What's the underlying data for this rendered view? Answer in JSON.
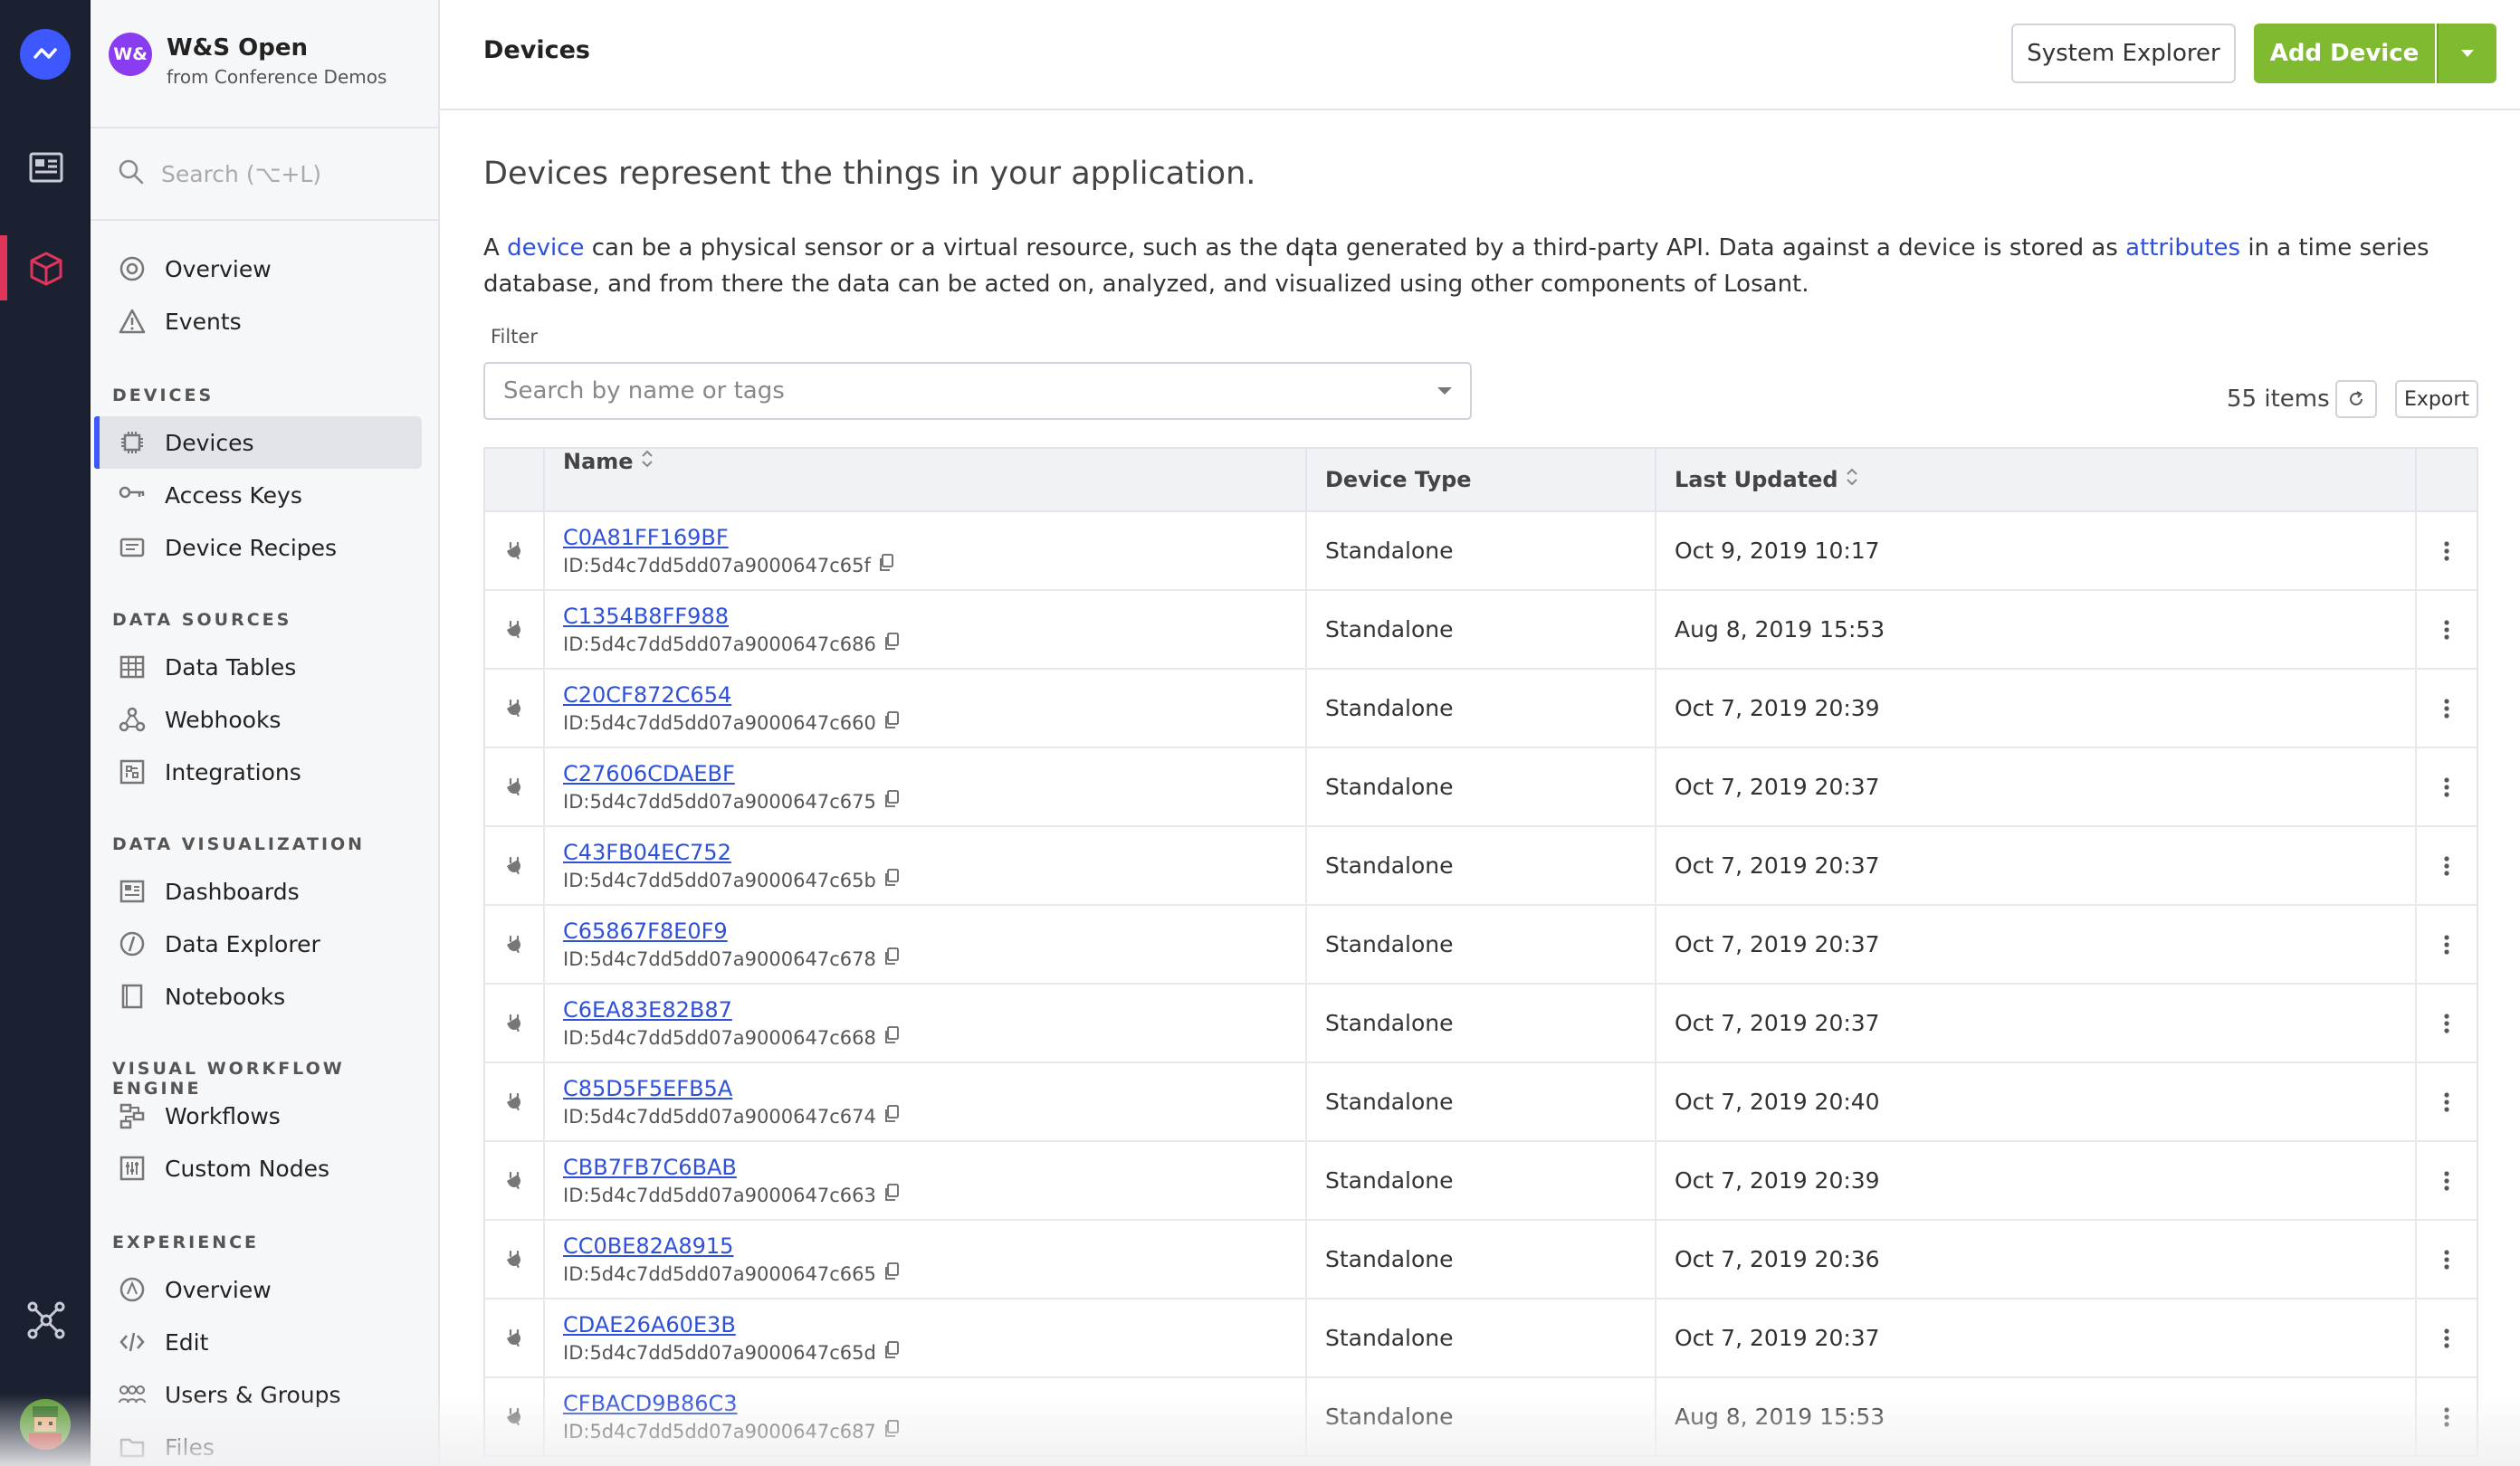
{
  "org": {
    "badge": "W&",
    "name": "W&S Open",
    "subtitle": "from Conference Demos"
  },
  "search": {
    "placeholder": "Search (⌥+L)"
  },
  "nav": {
    "overview": "Overview",
    "events": "Events",
    "sections": {
      "devices": "DEVICES",
      "data_sources": "DATA SOURCES",
      "data_visualization": "DATA VISUALIZATION",
      "visual_workflow_engine": "VISUAL WORKFLOW ENGINE",
      "experience": "EXPERIENCE"
    },
    "devices": "Devices",
    "access_keys": "Access Keys",
    "device_recipes": "Device Recipes",
    "data_tables": "Data Tables",
    "webhooks": "Webhooks",
    "integrations": "Integrations",
    "dashboards": "Dashboards",
    "data_explorer": "Data Explorer",
    "notebooks": "Notebooks",
    "workflows": "Workflows",
    "custom_nodes": "Custom Nodes",
    "exp_overview": "Overview",
    "edit": "Edit",
    "users_groups": "Users & Groups",
    "files": "Files"
  },
  "header": {
    "title": "Devices",
    "system_explorer": "System Explorer",
    "add_device": "Add Device"
  },
  "content": {
    "lead": "Devices represent the things in your application.",
    "desc_1": "A ",
    "desc_link_device": "device",
    "desc_2": " can be a physical sensor or a virtual resource, such as the data generated by a third-party API. Data against a device is stored as ",
    "desc_link_attributes": "attributes",
    "desc_3": " in a time series database, and from there the data can be acted on, analyzed, and visualized using other components of Losant.",
    "filter_label": "Filter",
    "filter_placeholder": "Search by name or tags",
    "items_count": "55 items",
    "export": "Export"
  },
  "table": {
    "headers": {
      "name": "Name",
      "device_type": "Device Type",
      "last_updated": "Last Updated"
    },
    "rows": [
      {
        "name": "C0A81FF169BF",
        "id": "ID:5d4c7dd5dd07a9000647c65f",
        "type": "Standalone",
        "updated": "Oct 9, 2019 10:17"
      },
      {
        "name": "C1354B8FF988",
        "id": "ID:5d4c7dd5dd07a9000647c686",
        "type": "Standalone",
        "updated": "Aug 8, 2019 15:53"
      },
      {
        "name": "C20CF872C654",
        "id": "ID:5d4c7dd5dd07a9000647c660",
        "type": "Standalone",
        "updated": "Oct 7, 2019 20:39"
      },
      {
        "name": "C27606CDAEBF",
        "id": "ID:5d4c7dd5dd07a9000647c675",
        "type": "Standalone",
        "updated": "Oct 7, 2019 20:37"
      },
      {
        "name": "C43FB04EC752",
        "id": "ID:5d4c7dd5dd07a9000647c65b",
        "type": "Standalone",
        "updated": "Oct 7, 2019 20:37"
      },
      {
        "name": "C65867F8E0F9",
        "id": "ID:5d4c7dd5dd07a9000647c678",
        "type": "Standalone",
        "updated": "Oct 7, 2019 20:37"
      },
      {
        "name": "C6EA83E82B87",
        "id": "ID:5d4c7dd5dd07a9000647c668",
        "type": "Standalone",
        "updated": "Oct 7, 2019 20:37"
      },
      {
        "name": "C85D5F5EFB5A",
        "id": "ID:5d4c7dd5dd07a9000647c674",
        "type": "Standalone",
        "updated": "Oct 7, 2019 20:40"
      },
      {
        "name": "CBB7FB7C6BAB",
        "id": "ID:5d4c7dd5dd07a9000647c663",
        "type": "Standalone",
        "updated": "Oct 7, 2019 20:39"
      },
      {
        "name": "CC0BE82A8915",
        "id": "ID:5d4c7dd5dd07a9000647c665",
        "type": "Standalone",
        "updated": "Oct 7, 2019 20:36"
      },
      {
        "name": "CDAE26A60E3B",
        "id": "ID:5d4c7dd5dd07a9000647c65d",
        "type": "Standalone",
        "updated": "Oct 7, 2019 20:37"
      },
      {
        "name": "CFBACD9B86C3",
        "id": "ID:5d4c7dd5dd07a9000647c687",
        "type": "Standalone",
        "updated": "Aug 8, 2019 15:53"
      }
    ]
  },
  "colors": {
    "accent": "#3d58ff",
    "add_button": "#7fba30",
    "link": "#2f50d8",
    "rail": "#1b2130",
    "active_rail": "#e0355b"
  }
}
